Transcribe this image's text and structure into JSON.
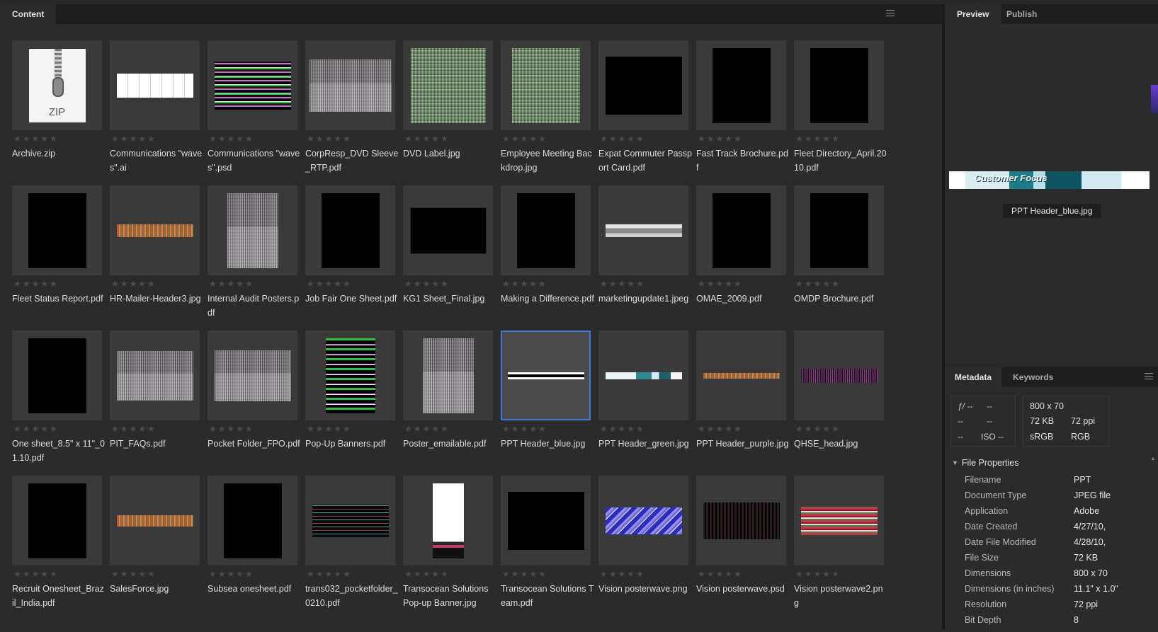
{
  "content_panel": {
    "tab_label": "Content"
  },
  "items": [
    {
      "name": "Archive.zip",
      "art": "zip",
      "w": 80,
      "h": 104,
      "label": "ZIP"
    },
    {
      "name": "Communications \"waves\".ai",
      "art": "white-strip",
      "w": 108,
      "h": 34
    },
    {
      "name": "Communications \"waves\".psd",
      "art": "magenta",
      "w": 108,
      "h": 68
    },
    {
      "name": "CorpResp_DVD Sleeve_RTP.pdf",
      "art": "noise-split",
      "w": 116,
      "h": 74
    },
    {
      "name": "DVD Label.jpg",
      "art": "green-noise",
      "w": 106,
      "h": 106
    },
    {
      "name": "Employee Meeting Backdrop.jpg",
      "art": "green-noise",
      "w": 96,
      "h": 106
    },
    {
      "name": "Expat Commuter Passport Card.pdf",
      "art": "black",
      "w": 108,
      "h": 82
    },
    {
      "name": "Fast Track Brochure.pdf",
      "art": "black",
      "w": 82,
      "h": 106
    },
    {
      "name": "Fleet Directory_April.2010.pdf",
      "art": "black",
      "w": 82,
      "h": 106
    },
    {
      "name": "Fleet Status Report.pdf",
      "art": "black",
      "w": 82,
      "h": 106
    },
    {
      "name": "HR-Mailer-Header3.jpg",
      "art": "orange-noise",
      "w": 108,
      "h": 18
    },
    {
      "name": "Internal Audit Posters.pdf",
      "art": "noise-split",
      "w": 72,
      "h": 106
    },
    {
      "name": "Job Fair One Sheet.pdf",
      "art": "black",
      "w": 82,
      "h": 106
    },
    {
      "name": "KG1 Sheet_Final.jpg",
      "art": "kg1",
      "w": 108,
      "h": 66
    },
    {
      "name": "Making a Difference.pdf",
      "art": "black",
      "w": 82,
      "h": 106
    },
    {
      "name": "marketingupdate1.jpeg",
      "art": "grey-header",
      "w": 108,
      "h": 18
    },
    {
      "name": "OMAE_2009.pdf",
      "art": "black",
      "w": 82,
      "h": 106
    },
    {
      "name": "OMDP Brochure.pdf",
      "art": "black",
      "w": 82,
      "h": 106
    },
    {
      "name": "One sheet_8.5\" x 11\"_01.10.pdf",
      "art": "black",
      "w": 82,
      "h": 106
    },
    {
      "name": "PIT_FAQs.pdf",
      "art": "noise-split",
      "w": 108,
      "h": 70
    },
    {
      "name": "Pocket Folder_FPO.pdf",
      "art": "noise-split",
      "w": 108,
      "h": 72
    },
    {
      "name": "Pop-Up Banners.pdf",
      "art": "green-bars",
      "w": 70,
      "h": 106
    },
    {
      "name": "Poster_emailable.pdf",
      "art": "noise-split",
      "w": 72,
      "h": 106
    },
    {
      "name": "PPT Header_blue.jpg",
      "art": "black-band",
      "w": 108,
      "h": 10,
      "selected": true
    },
    {
      "name": "PPT Header_green.jpg",
      "art": "blue-header",
      "w": 108,
      "h": 10
    },
    {
      "name": "PPT Header_purple.jpg",
      "art": "orange-noise",
      "w": 108,
      "h": 8
    },
    {
      "name": "QHSE_head.jpg",
      "art": "purple-band",
      "w": 108,
      "h": 20
    },
    {
      "name": "Recruit Onesheet_Brazil_India.pdf",
      "art": "black",
      "w": 82,
      "h": 106
    },
    {
      "name": "SalesForce.jpg",
      "art": "orange-noise",
      "w": 108,
      "h": 16
    },
    {
      "name": "Subsea onesheet.pdf",
      "art": "black",
      "w": 82,
      "h": 106
    },
    {
      "name": "trans032_pocketfolder_0210.pdf",
      "art": "dark-noise",
      "w": 108,
      "h": 46
    },
    {
      "name": "Transocean Solutions Pop-up Banner.jpg",
      "art": "pink-white",
      "w": 44,
      "h": 106
    },
    {
      "name": "Transocean Solutions Team.pdf",
      "art": "black",
      "w": 108,
      "h": 82
    },
    {
      "name": "Vision posterwave.png",
      "art": "blue-stripes",
      "w": 108,
      "h": 38
    },
    {
      "name": "Vision posterwave.psd",
      "art": "dark-band",
      "w": 108,
      "h": 52
    },
    {
      "name": "Vision posterwave2.png",
      "art": "red-green",
      "w": 108,
      "h": 40
    }
  ],
  "preview": {
    "tab_preview": "Preview",
    "tab_publish": "Publish",
    "image_caption_art": "Customer Focus",
    "filename_caption": "PPT Header_blue.jpg"
  },
  "metadata": {
    "tab_metadata": "Metadata",
    "tab_keywords": "Keywords",
    "camera": {
      "fstop": "ƒ/ --",
      "exposure": "--",
      "r2c1": "--",
      "r2c2": "--",
      "r3c1": "--",
      "iso": "ISO --"
    },
    "summary": {
      "dimensions": "800 x 70",
      "size": "72 KB",
      "ppi": "72 ppi",
      "color_profile": "sRGB",
      "color_mode": "RGB"
    },
    "section_title": "File Properties",
    "properties": [
      {
        "key": "Filename",
        "value": "PPT"
      },
      {
        "key": "Document Type",
        "value": "JPEG file"
      },
      {
        "key": "Application",
        "value": "Adobe"
      },
      {
        "key": "Date Created",
        "value": "4/27/10,"
      },
      {
        "key": "Date File Modified",
        "value": "4/28/10,"
      },
      {
        "key": "File Size",
        "value": "72 KB"
      },
      {
        "key": "Dimensions",
        "value": "800 x 70"
      },
      {
        "key": "Dimensions (in inches)",
        "value": "11.1\" x 1.0\""
      },
      {
        "key": "Resolution",
        "value": "72 ppi"
      },
      {
        "key": "Bit Depth",
        "value": "8"
      }
    ]
  }
}
